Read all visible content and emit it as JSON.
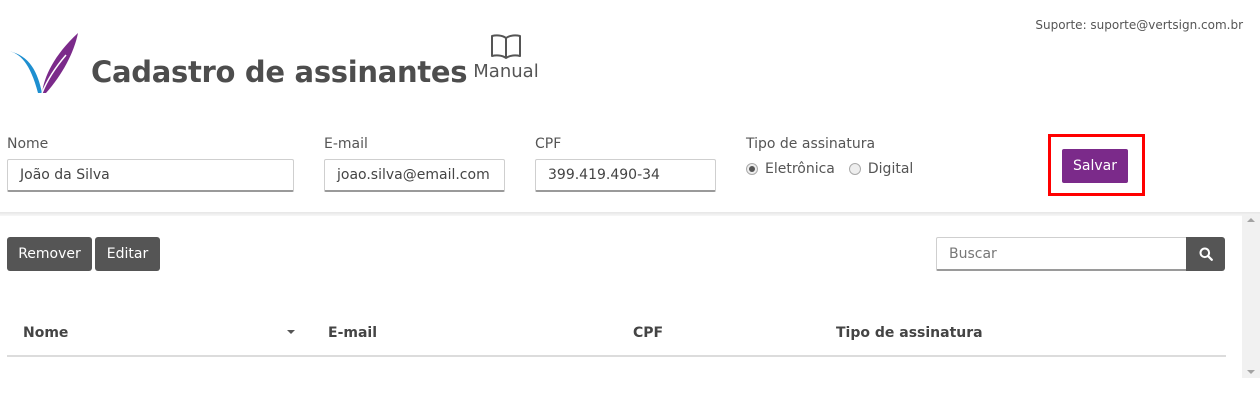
{
  "header": {
    "support_text": "Suporte: suporte@vertsign.com.br",
    "title": "Cadastro de assinantes",
    "manual_label": "Manual"
  },
  "form": {
    "name_label": "Nome",
    "name_value": "João da Silva",
    "email_label": "E-mail",
    "email_value": "joao.silva@email.com",
    "cpf_label": "CPF",
    "cpf_value": "399.419.490-34",
    "type_label": "Tipo de assinatura",
    "type_options": [
      {
        "label": "Eletrônica",
        "selected": true
      },
      {
        "label": "Digital",
        "selected": false
      }
    ],
    "save_label": "Salvar"
  },
  "toolbar": {
    "remove_label": "Remover",
    "edit_label": "Editar",
    "search_placeholder": "Buscar"
  },
  "table": {
    "columns": [
      "Nome",
      "E-mail",
      "CPF",
      "Tipo de assinatura"
    ],
    "rows": []
  },
  "colors": {
    "brand_purple": "#7b2a8a",
    "brand_blue": "#1e8fd0",
    "dark_button": "#555555",
    "highlight": "#ff0000"
  }
}
